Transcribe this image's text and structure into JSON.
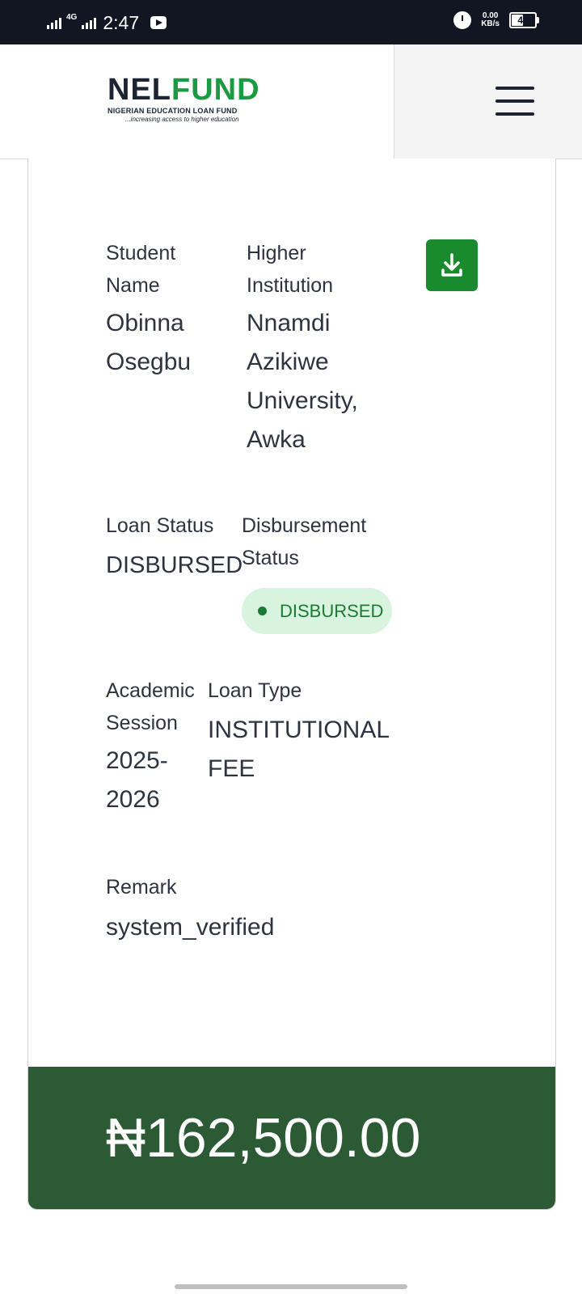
{
  "status_bar": {
    "network": "4G",
    "time": "2:47",
    "speed_value": "0.00",
    "speed_unit": "KB/s",
    "battery": "47"
  },
  "header": {
    "logo_part1": "NEL",
    "logo_part2": "FUND",
    "logo_subtitle": "NIGERIAN EDUCATION LOAN FUND",
    "logo_tagline": "...increasing access to higher education",
    "menu_icon": "hamburger-menu-icon"
  },
  "loan": {
    "student_name_label": "Student Name",
    "student_name": "Obinna Osegbu",
    "institution_label": "Higher Institution",
    "institution": "Nnamdi Azikiwe University, Awka",
    "download_icon": "download-icon",
    "loan_status_label": "Loan Status",
    "loan_status": "DISBURSED",
    "disbursement_status_label": "Disbursement Status",
    "disbursement_status": "DISBURSED",
    "session_label": "Academic Session",
    "session": "2025-2026",
    "loan_type_label": "Loan Type",
    "loan_type": "INSTITUTIONAL FEE",
    "remark_label": "Remark",
    "remark": "system_verified",
    "amount": "₦162,500.00"
  },
  "colors": {
    "brand_green": "#1a9a43",
    "button_green": "#1a8a2e",
    "amount_bar": "#2b5a34",
    "badge_bg": "#d8f3de"
  }
}
